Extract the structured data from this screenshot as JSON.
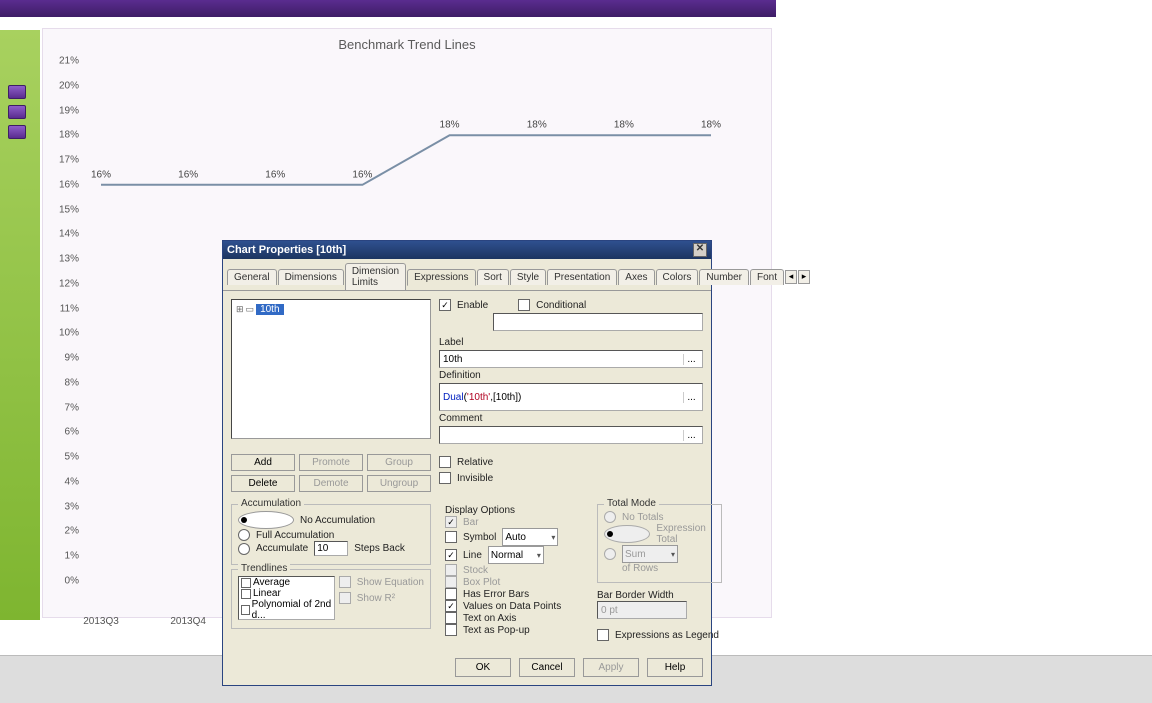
{
  "chart_data": {
    "type": "line",
    "title": "Benchmark Trend Lines",
    "categories": [
      "2013Q3",
      "2013Q4",
      "",
      "",
      "",
      "",
      "",
      ""
    ],
    "values": [
      16,
      16,
      16,
      16,
      18,
      18,
      18,
      18
    ],
    "ylim": [
      0,
      21
    ],
    "yticks": [
      "0%",
      "1%",
      "2%",
      "3%",
      "4%",
      "5%",
      "6%",
      "7%",
      "8%",
      "9%",
      "10%",
      "11%",
      "12%",
      "13%",
      "14%",
      "15%",
      "16%",
      "17%",
      "18%",
      "19%",
      "20%",
      "21%"
    ],
    "point_labels": [
      "16%",
      "16%",
      "16%",
      "16%",
      "18%",
      "18%",
      "18%",
      "18%"
    ],
    "series_name": "10th"
  },
  "dlg": {
    "title": "Chart Properties [10th]",
    "tabs": [
      "General",
      "Dimensions",
      "Dimension Limits",
      "Expressions",
      "Sort",
      "Style",
      "Presentation",
      "Axes",
      "Colors",
      "Number",
      "Font"
    ],
    "active_tab": "Expressions",
    "tree_item": "10th",
    "enable": "Enable",
    "conditional": "Conditional",
    "label_lbl": "Label",
    "label_val": "10th",
    "definition_lbl": "Definition",
    "definition_val": {
      "func": "Dual",
      "a": "'10th'",
      "b": "[10th]"
    },
    "comment_lbl": "Comment",
    "comment_val": "",
    "btns": {
      "add": "Add",
      "promote": "Promote",
      "group": "Group",
      "delete": "Delete",
      "demote": "Demote",
      "ungroup": "Ungroup"
    },
    "relative": "Relative",
    "invisible": "Invisible",
    "accum": {
      "grp": "Accumulation",
      "none": "No Accumulation",
      "full": "Full Accumulation",
      "acc": "Accumulate",
      "steps": "Steps Back",
      "steps_val": "10"
    },
    "trend": {
      "grp": "Trendlines",
      "items": [
        "Average",
        "Linear",
        "Polynomial of 2nd d..."
      ],
      "show_eq": "Show Equation",
      "show_r2": "Show R²"
    },
    "disp": {
      "grp": "Display Options",
      "bar": "Bar",
      "symbol": "Symbol",
      "symbol_val": "Auto",
      "line": "Line",
      "line_val": "Normal",
      "stock": "Stock",
      "box": "Box Plot",
      "err": "Has Error Bars",
      "vals": "Values on Data Points",
      "txtaxis": "Text on Axis",
      "popup": "Text as Pop-up"
    },
    "total": {
      "grp": "Total Mode",
      "none": "No Totals",
      "expr": "Expression Total",
      "sum": "Sum",
      "rows": "of Rows"
    },
    "bbw": {
      "lbl": "Bar Border Width",
      "val": "0 pt"
    },
    "exprleg": "Expressions as Legend",
    "footer": {
      "ok": "OK",
      "cancel": "Cancel",
      "apply": "Apply",
      "help": "Help"
    }
  }
}
